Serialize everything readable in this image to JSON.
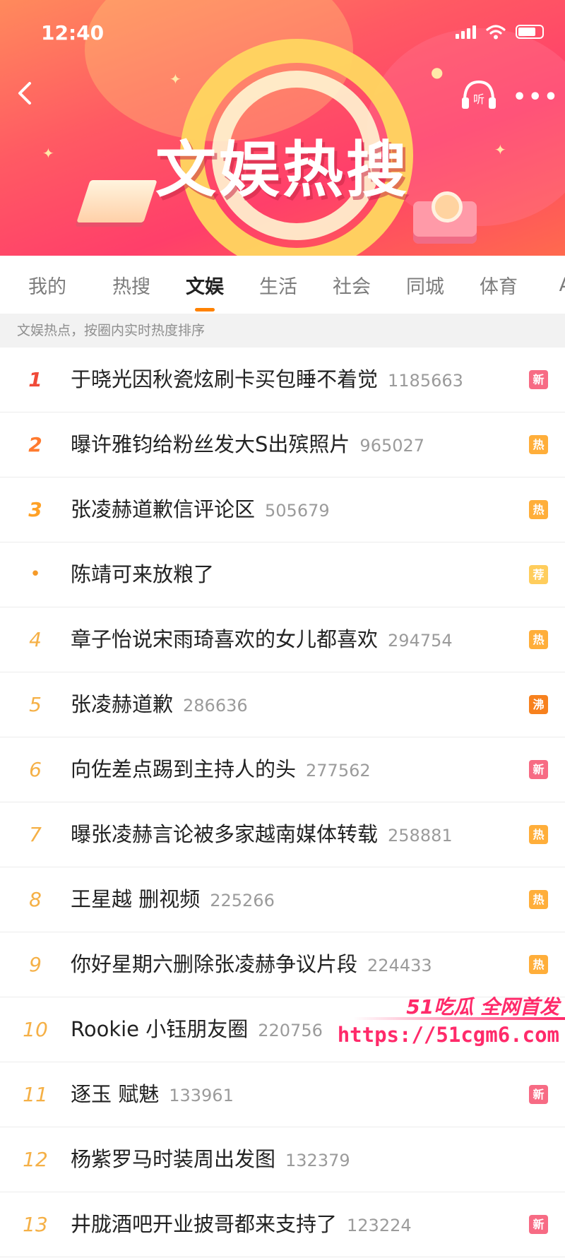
{
  "status_bar": {
    "time": "12:40"
  },
  "header": {
    "title": "文娱热搜",
    "listen_label": "听"
  },
  "tabs": [
    "我的",
    "热搜",
    "文娱",
    "生活",
    "社会",
    "同城",
    "体育",
    "AC"
  ],
  "active_tab": "文娱",
  "subtitle": "文娱热点，按圈内实时热度排序",
  "list": [
    {
      "rank": "1",
      "title": "于晓光因秋瓷炫刷卡买包睡不着觉",
      "count": "1185663",
      "tag": "新",
      "tag_type": "new"
    },
    {
      "rank": "2",
      "title": "曝许雅钧给粉丝发大S出殡照片",
      "count": "965027",
      "tag": "热",
      "tag_type": "hot"
    },
    {
      "rank": "3",
      "title": "张凌赫道歉信评论区",
      "count": "505679",
      "tag": "热",
      "tag_type": "hot"
    },
    {
      "rank": "•",
      "title": "陈靖可来放粮了",
      "count": "",
      "tag": "荐",
      "tag_type": "rec"
    },
    {
      "rank": "4",
      "title": "章子怡说宋雨琦喜欢的女儿都喜欢",
      "count": "294754",
      "tag": "热",
      "tag_type": "hot"
    },
    {
      "rank": "5",
      "title": "张凌赫道歉",
      "count": "286636",
      "tag": "沸",
      "tag_type": "boil"
    },
    {
      "rank": "6",
      "title": "向佐差点踢到主持人的头",
      "count": "277562",
      "tag": "新",
      "tag_type": "new"
    },
    {
      "rank": "7",
      "title": "曝张凌赫言论被多家越南媒体转载",
      "count": "258881",
      "tag": "热",
      "tag_type": "hot"
    },
    {
      "rank": "8",
      "title": "王星越 删视频",
      "count": "225266",
      "tag": "热",
      "tag_type": "hot"
    },
    {
      "rank": "9",
      "title": "你好星期六删除张凌赫争议片段",
      "count": "224433",
      "tag": "热",
      "tag_type": "hot"
    },
    {
      "rank": "10",
      "title": "Rookie 小钰朋友圈",
      "count": "220756",
      "tag": "",
      "tag_type": ""
    },
    {
      "rank": "11",
      "title": "逐玉 赋魅",
      "count": "133961",
      "tag": "新",
      "tag_type": "new"
    },
    {
      "rank": "12",
      "title": "杨紫罗马时装周出发图",
      "count": "132379",
      "tag": "",
      "tag_type": ""
    },
    {
      "rank": "13",
      "title": "井胧酒吧开业披哥都来支持了",
      "count": "123224",
      "tag": "新",
      "tag_type": "new"
    }
  ],
  "watermark": {
    "line1": "51吃瓜 全网首发",
    "line2": "https://51cgm6.com"
  },
  "colors": {
    "accent": "#ff8200",
    "banner": "#ff4f66",
    "tag_new": "#f76b84",
    "tag_hot": "#ffae3a",
    "tag_rec": "#ffcd5c",
    "tag_boil": "#f7811e",
    "watermark": "#ff2a6a"
  },
  "icons": [
    "back-arrow-icon",
    "headphones-icon",
    "more-dots-icon",
    "signal-icon",
    "wifi-icon",
    "battery-icon"
  ]
}
